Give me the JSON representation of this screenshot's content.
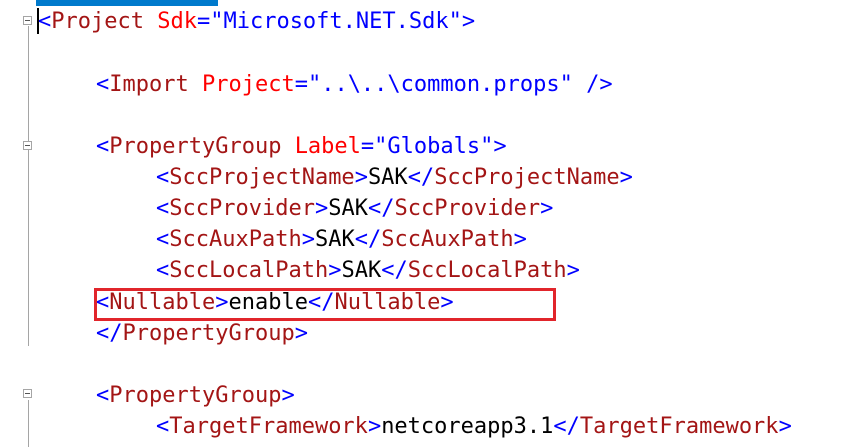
{
  "lines": [
    {
      "tag_open": "<",
      "tag": "Project",
      "attr": "Sdk",
      "eq": "=",
      "value": "\"Microsoft.NET.Sdk\"",
      "close": ">"
    },
    {
      "tag_open": "<",
      "tag": "Import",
      "attr": "Project",
      "eq": "=",
      "value": "\"..\\..\\common.props\"",
      "close": " />"
    },
    {
      "tag_open": "<",
      "tag": "PropertyGroup",
      "attr": "Label",
      "eq": "=",
      "value": "\"Globals\"",
      "close": ">"
    },
    {
      "open": "<",
      "tag": "SccProjectName",
      "gt": ">",
      "text": "SAK",
      "end_open": "</",
      "end_tag": "SccProjectName",
      "end_gt": ">"
    },
    {
      "open": "<",
      "tag": "SccProvider",
      "gt": ">",
      "text": "SAK",
      "end_open": "</",
      "end_tag": "SccProvider",
      "end_gt": ">"
    },
    {
      "open": "<",
      "tag": "SccAuxPath",
      "gt": ">",
      "text": "SAK",
      "end_open": "</",
      "end_tag": "SccAuxPath",
      "end_gt": ">"
    },
    {
      "open": "<",
      "tag": "SccLocalPath",
      "gt": ">",
      "text": "SAK",
      "end_open": "</",
      "end_tag": "SccLocalPath",
      "end_gt": ">"
    },
    {
      "open": "<",
      "tag": "Nullable",
      "gt": ">",
      "text": "enable",
      "end_open": "</",
      "end_tag": "Nullable",
      "end_gt": ">"
    },
    {
      "end_open": "</",
      "end_tag": "PropertyGroup",
      "end_gt": ">"
    },
    {
      "open": "<",
      "tag": "PropertyGroup",
      "gt": ">"
    },
    {
      "open": "<",
      "tag": "TargetFramework",
      "gt": ">",
      "text": "netcoreapp3.1",
      "end_open": "</",
      "end_tag": "TargetFramework",
      "end_gt": ">"
    }
  ],
  "colors": {
    "delimiter": "#0000ff",
    "element": "#a31515",
    "attribute_name": "#ff0000",
    "attribute_value": "#0000ff",
    "text": "#000000",
    "highlight_border": "#e1252b",
    "tab_accent": "#007acc"
  },
  "icons": {
    "fold": "collapse-minus-icon"
  }
}
